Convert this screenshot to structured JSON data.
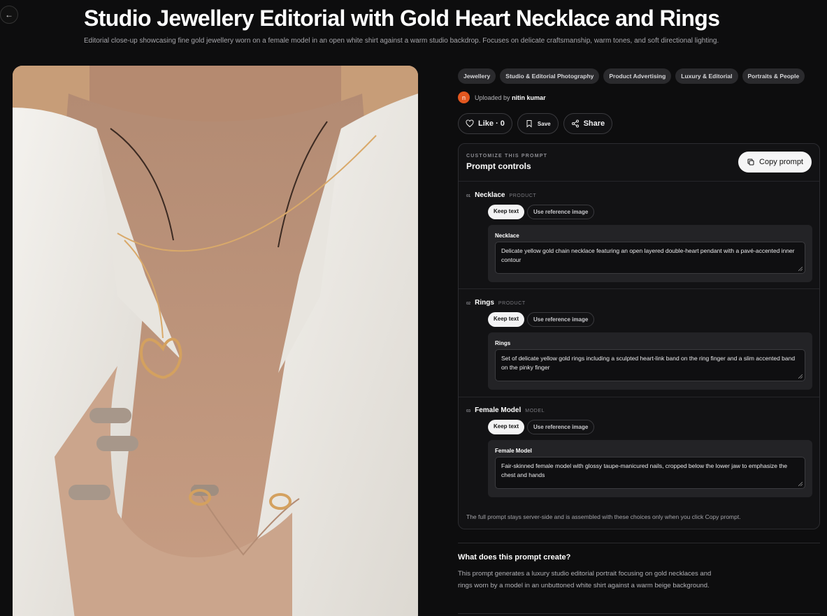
{
  "header": {
    "back_label": "←",
    "title": "Studio Jewellery Editorial with Gold Heart Necklace and Rings",
    "description": "Editorial close-up showcasing fine gold jewellery worn on a female model in an open white shirt against a warm studio backdrop. Focuses on delicate craftsmanship, warm tones, and soft directional lighting."
  },
  "tags": [
    "Jewellery",
    "Studio & Editorial Photography",
    "Product Advertising",
    "Luxury & Editorial",
    "Portraits & People"
  ],
  "uploader": {
    "avatar_letter": "n",
    "prefix": "Uploaded by",
    "name": "nitin kumar"
  },
  "actions": {
    "like": "Like · 0",
    "save": "Save",
    "share": "Share"
  },
  "controls": {
    "kicker": "CUSTOMIZE THIS PROMPT",
    "title": "Prompt controls",
    "copy_label": "Copy prompt",
    "items": [
      {
        "num": "01",
        "name": "Necklace",
        "type": "PRODUCT",
        "keep": "Keep text",
        "ref": "Use reference image",
        "field_label": "Necklace",
        "value": "Delicate yellow gold chain necklace featuring an open layered double-heart pendant with a pavé-accented inner contour"
      },
      {
        "num": "02",
        "name": "Rings",
        "type": "PRODUCT",
        "keep": "Keep text",
        "ref": "Use reference image",
        "field_label": "Rings",
        "value": "Set of delicate yellow gold rings including a sculpted heart-link band on the ring finger and a slim accented band on the pinky finger"
      },
      {
        "num": "03",
        "name": "Female Model",
        "type": "MODEL",
        "keep": "Keep text",
        "ref": "Use reference image",
        "field_label": "Female Model",
        "value": "Fair-skinned female model with glossy taupe-manicured nails, cropped below the lower jaw to emphasize the chest and hands"
      }
    ],
    "note": "The full prompt stays server-side and is assembled with these choices only when you click Copy prompt."
  },
  "about": {
    "heading": "What does this prompt create?",
    "body": "This prompt generates a luxury studio editorial portrait focusing on gold necklaces and rings worn by a model in an unbuttoned white shirt against a warm beige background."
  },
  "colors": {
    "background": "#0d0d0e",
    "avatar": "#e2571f",
    "panel": "#121214"
  }
}
